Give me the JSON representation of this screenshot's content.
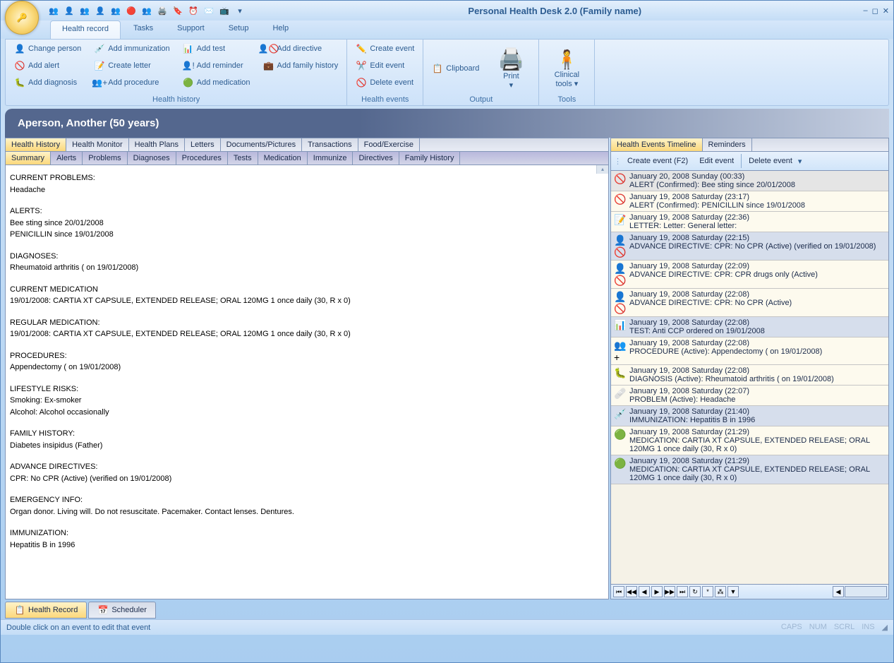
{
  "title": "Personal Health Desk 2.0 (Family name)",
  "ribbon_tabs": [
    "Health record",
    "Tasks",
    "Support",
    "Setup",
    "Help"
  ],
  "ribbon": {
    "health_history": {
      "label": "Health history",
      "btns": {
        "change_person": "Change person",
        "add_alert": "Add alert",
        "add_diagnosis": "Add diagnosis",
        "add_immunization": "Add immunization",
        "create_letter": "Create letter",
        "add_procedure": "Add procedure",
        "add_test": "Add test",
        "add_reminder": "Add reminder",
        "add_medication": "Add medication",
        "add_directive": "Add directive",
        "add_family_history": "Add family history"
      }
    },
    "health_events": {
      "label": "Health events",
      "btns": {
        "create": "Create event",
        "edit": "Edit event",
        "delete": "Delete event"
      }
    },
    "output": {
      "label": "Output",
      "clipboard": "Clipboard",
      "print": "Print"
    },
    "tools": {
      "label": "Tools",
      "clinical": "Clinical tools"
    }
  },
  "patient_header": "Aperson, Another (50  years)",
  "left_tabs": [
    "Health History",
    "Health Monitor",
    "Health Plans",
    "Letters",
    "Documents/Pictures",
    "Transactions",
    "Food/Exercise"
  ],
  "left_subtabs": [
    "Summary",
    "Alerts",
    "Problems",
    "Diagnoses",
    "Procedures",
    "Tests",
    "Medication",
    "Immunize",
    "Directives",
    "Family History"
  ],
  "summary_sections": [
    {
      "h": "CURRENT PROBLEMS:",
      "lines": [
        "Headache"
      ]
    },
    {
      "h": "ALERTS:",
      "lines": [
        "Bee sting since 20/01/2008",
        "PENICILLIN since 19/01/2008"
      ]
    },
    {
      "h": "DIAGNOSES:",
      "lines": [
        "Rheumatoid arthritis ( on 19/01/2008)"
      ]
    },
    {
      "h": "CURRENT MEDICATION",
      "lines": [
        "19/01/2008: CARTIA XT CAPSULE, EXTENDED RELEASE; ORAL 120MG 1  once daily    (30, R x 0)"
      ]
    },
    {
      "h": "REGULAR MEDICATION:",
      "lines": [
        "19/01/2008: CARTIA XT CAPSULE, EXTENDED RELEASE; ORAL 120MG 1  once daily    (30, R x 0)"
      ]
    },
    {
      "h": "PROCEDURES:",
      "lines": [
        "Appendectomy ( on 19/01/2008)"
      ]
    },
    {
      "h": "LIFESTYLE RISKS:",
      "lines": [
        "Smoking: Ex-smoker",
        "Alcohol: Alcohol occasionally"
      ]
    },
    {
      "h": "FAMILY HISTORY:",
      "lines": [
        "Diabetes insipidus (Father)"
      ]
    },
    {
      "h": "ADVANCE DIRECTIVES:",
      "lines": [
        "CPR: No CPR (Active) (verified on 19/01/2008)"
      ]
    },
    {
      "h": "EMERGENCY INFO:",
      "lines": [
        "Organ donor. Living will. Do not resuscitate. Pacemaker. Contact lenses. Dentures."
      ]
    },
    {
      "h": "IMMUNIZATION:",
      "lines": [
        "Hepatitis B  in 1996"
      ]
    }
  ],
  "right_tabs": [
    "Health Events Timeline",
    "Reminders"
  ],
  "timeline_toolbar": {
    "create": "Create event (F2)",
    "edit": "Edit event",
    "delete": "Delete event"
  },
  "timeline": [
    {
      "cls": "selected",
      "icon": "🚫",
      "date": "January 20, 2008 Sunday (00:33)",
      "desc": "ALERT (Confirmed): Bee sting since 20/01/2008"
    },
    {
      "cls": "cream",
      "icon": "🚫",
      "date": "January 19, 2008 Saturday (23:17)",
      "desc": "ALERT (Confirmed): PENICILLIN since 19/01/2008"
    },
    {
      "cls": "cream",
      "icon": "📝",
      "date": "January 19, 2008 Saturday (22:36)",
      "desc": "LETTER: Letter: General letter:"
    },
    {
      "cls": "blue",
      "icon": "👤🚫",
      "date": "January 19, 2008 Saturday (22:15)",
      "desc": "ADVANCE DIRECTIVE: CPR: No CPR (Active) (verified on 19/01/2008)"
    },
    {
      "cls": "cream",
      "icon": "👤🚫",
      "date": "January 19, 2008 Saturday (22:09)",
      "desc": "ADVANCE DIRECTIVE: CPR: CPR drugs only (Active)"
    },
    {
      "cls": "cream",
      "icon": "👤🚫",
      "date": "January 19, 2008 Saturday (22:08)",
      "desc": "ADVANCE DIRECTIVE: CPR: No CPR (Active)"
    },
    {
      "cls": "blue",
      "icon": "📊",
      "date": "January 19, 2008 Saturday (22:08)",
      "desc": "TEST: Anti CCP ordered on 19/01/2008"
    },
    {
      "cls": "cream",
      "icon": "👥+",
      "date": "January 19, 2008 Saturday (22:08)",
      "desc": "PROCEDURE (Active): Appendectomy ( on 19/01/2008)"
    },
    {
      "cls": "cream",
      "icon": "🐛",
      "date": "January 19, 2008 Saturday (22:08)",
      "desc": "DIAGNOSIS (Active): Rheumatoid arthritis ( on 19/01/2008)"
    },
    {
      "cls": "cream",
      "icon": "🩹",
      "date": "January 19, 2008 Saturday (22:07)",
      "desc": "PROBLEM (Active): Headache"
    },
    {
      "cls": "blue",
      "icon": "💉",
      "date": "January 19, 2008 Saturday (21:40)",
      "desc": "IMMUNIZATION: Hepatitis B  in 1996"
    },
    {
      "cls": "cream",
      "icon": "🟢",
      "date": "January 19, 2008 Saturday (21:29)",
      "desc": "MEDICATION: CARTIA XT CAPSULE, EXTENDED RELEASE; ORAL 120MG 1  once daily    (30, R x 0)"
    },
    {
      "cls": "blue",
      "icon": "🟢",
      "date": "January 19, 2008 Saturday (21:29)",
      "desc": "MEDICATION: CARTIA XT CAPSULE, EXTENDED RELEASE; ORAL 120MG 1  once daily    (30, R x 0)"
    }
  ],
  "bottom_tabs": {
    "record": "Health Record",
    "scheduler": "Scheduler"
  },
  "status_text": "Double click on an event to edit that event",
  "status_indicators": [
    "CAPS",
    "NUM",
    "SCRL",
    "INS"
  ],
  "icons": {
    "change_person": "👤",
    "add_alert": "🚫",
    "add_diagnosis": "🐛",
    "add_immunization": "💉",
    "create_letter": "📝",
    "add_procedure": "👥+",
    "add_test": "📊",
    "add_reminder": "👤!",
    "add_medication": "🟢",
    "add_directive": "👤🚫",
    "add_family_history": "💼",
    "create_event": "✏️",
    "edit_event": "✂️",
    "delete_event": "🚫",
    "clipboard": "📋",
    "print": "🖨️",
    "clinical": "🧍",
    "record": "📋",
    "scheduler": "📅",
    "app": "🔑"
  }
}
